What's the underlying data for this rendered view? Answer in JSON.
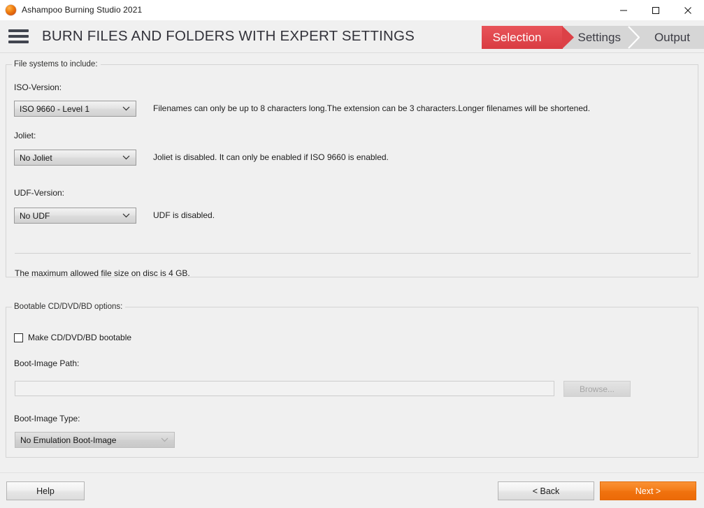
{
  "window": {
    "title": "Ashampoo Burning Studio 2021",
    "icon": "app-flame-icon",
    "controls": {
      "minimize": "minimize-icon",
      "maximize": "maximize-icon",
      "close": "close-icon"
    }
  },
  "header": {
    "menu_icon": "hamburger-menu-icon",
    "title": "BURN FILES AND FOLDERS WITH EXPERT SETTINGS",
    "steps": [
      {
        "label": "Selection",
        "active": true
      },
      {
        "label": "Settings",
        "active": false
      },
      {
        "label": "Output",
        "active": false
      }
    ]
  },
  "filesystems": {
    "legend": "File systems to include:",
    "iso": {
      "label": "ISO-Version:",
      "value": "ISO 9660 - Level 1",
      "description": "Filenames can only be up to 8 characters long.The extension can be 3 characters.Longer filenames will be shortened."
    },
    "joliet": {
      "label": "Joliet:",
      "value": "No Joliet",
      "description": "Joliet is disabled. It can only be enabled if ISO 9660 is enabled."
    },
    "udf": {
      "label": "UDF-Version:",
      "value": "No UDF",
      "description": "UDF is disabled."
    },
    "note": "The maximum allowed file size on disc is 4 GB."
  },
  "bootable": {
    "legend": "Bootable CD/DVD/BD options:",
    "make_bootable_label": "Make CD/DVD/BD bootable",
    "make_bootable_checked": false,
    "boot_image_path_label": "Boot-Image Path:",
    "boot_image_path_value": "",
    "boot_image_path_placeholder": "",
    "browse_label": "Browse...",
    "boot_image_type_label": "Boot-Image Type:",
    "boot_image_type_value": "No Emulation Boot-Image"
  },
  "footer": {
    "help_label": "Help",
    "back_label": "< Back",
    "next_label": "Next >"
  },
  "colors": {
    "accent_orange": "#f47b18",
    "active_step_red": "#d93c42",
    "page_background": "#f0f0f0",
    "step_background": "#d6d6d6"
  }
}
